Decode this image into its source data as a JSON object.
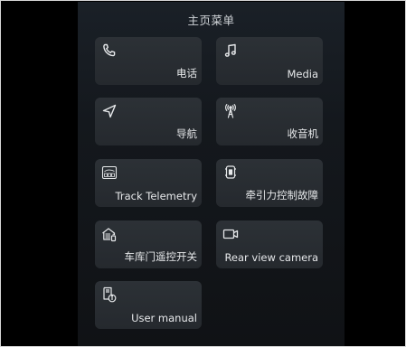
{
  "menu": {
    "title": "主页菜单",
    "items": [
      {
        "label": "电话",
        "icon": "phone-icon"
      },
      {
        "label": "Media",
        "icon": "music-note-icon"
      },
      {
        "label": "导航",
        "icon": "navigation-arrow-icon"
      },
      {
        "label": "收音机",
        "icon": "radio-antenna-icon"
      },
      {
        "label": "Track Telemetry",
        "icon": "telemetry-gauge-icon"
      },
      {
        "label": "牵引力控制故障",
        "icon": "traction-control-icon"
      },
      {
        "label": "车库门遥控开关",
        "icon": "garage-door-remote-icon"
      },
      {
        "label": "Rear view camera",
        "icon": "camera-icon"
      },
      {
        "label": "User manual",
        "icon": "user-manual-icon"
      }
    ]
  },
  "colors": {
    "background": "#000000",
    "panel": "#14181d",
    "tile": "#2a2e33",
    "text": "#e6e8ea"
  }
}
